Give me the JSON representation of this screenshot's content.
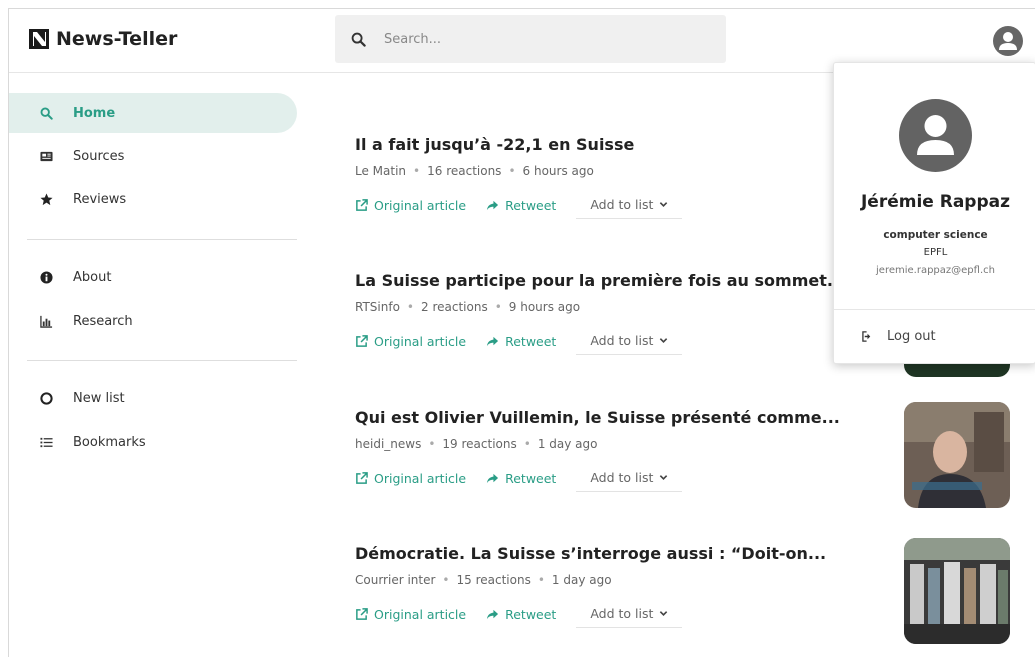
{
  "app": {
    "name": "News-Teller"
  },
  "search": {
    "placeholder": "Search..."
  },
  "sidebar": {
    "items": [
      {
        "label": "Home",
        "icon": "search-icon"
      },
      {
        "label": "Sources",
        "icon": "newspaper-icon"
      },
      {
        "label": "Reviews",
        "icon": "star-icon"
      },
      {
        "label": "About",
        "icon": "info-icon"
      },
      {
        "label": "Research",
        "icon": "chart-icon"
      },
      {
        "label": "New list",
        "icon": "plus-circle-icon"
      },
      {
        "label": "Bookmarks",
        "icon": "list-icon"
      }
    ],
    "active": "Home"
  },
  "actions": {
    "original": "Original article",
    "retweet": "Retweet",
    "add_to_list": "Add to list"
  },
  "articles": [
    {
      "title": "Il a fait jusqu’à -22,1 en Suisse",
      "source": "Le Matin",
      "reactions": "16 reactions",
      "time": "6 hours ago"
    },
    {
      "title": "La Suisse participe pour la première fois au sommet...",
      "source": "RTSinfo",
      "reactions": "2 reactions",
      "time": "9 hours ago"
    },
    {
      "title": "Qui est Olivier Vuillemin, le Suisse présenté comme...",
      "source": "heidi_news",
      "reactions": "19 reactions",
      "time": "1 day ago"
    },
    {
      "title": "Démocratie. La Suisse s’interroge aussi : “Doit-on...",
      "source": "Courrier inter",
      "reactions": "15 reactions",
      "time": "1 day ago"
    }
  ],
  "user": {
    "name": "Jérémie Rappaz",
    "department": "computer science",
    "organization": "EPFL",
    "email": "jeremie.rappaz@epfl.ch",
    "logout_label": "Log out"
  },
  "colors": {
    "accent": "#2a9d86",
    "active_bg": "#e2efec"
  }
}
